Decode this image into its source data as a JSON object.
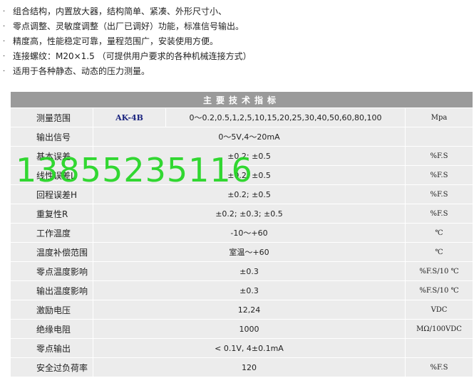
{
  "features": [
    {
      "bullet": "·",
      "text": "组合结构，内置放大器，结构简单、紧凑、外形尺寸小、"
    },
    {
      "bullet": "·",
      "text": "零点调整、灵敏度调整（出厂已调好）功能，标准信号输出。"
    },
    {
      "bullet": "·",
      "text": "精度高，性能稳定可靠，量程范围广，安装使用方便。"
    },
    {
      "bullet": "·",
      "text": "连接螺纹：M20×1.5 （可提供用户要求的各种机械连接方式）"
    },
    {
      "bullet": "·",
      "text": "适用于各种静态、动态的压力测量。"
    }
  ],
  "table": {
    "title": "主要技术指标",
    "range_row": {
      "name": "测量范围",
      "model": "AK-4B",
      "value": "0～0.2,0.5,1,2,5,10,15,20,25,30,40,50,60,80,100",
      "unit": "Mpa"
    },
    "rows": [
      {
        "name": "输出信号",
        "value": "0～5V,4～20mA",
        "unit": ""
      },
      {
        "name": "基本误差",
        "value": "±0.2; ±0.5",
        "unit": "%F.S"
      },
      {
        "name": "线性误差L",
        "value": "±0.2; ±0.5",
        "unit": "%F.S"
      },
      {
        "name": "回程误差H",
        "value": "±0.2; ±0.5",
        "unit": "%F.S"
      },
      {
        "name": "重复性R",
        "value": "±0.2; ±0.3; ±0.5",
        "unit": "%F.S"
      },
      {
        "name": "工作温度",
        "value": "-10～+60",
        "unit": "℃"
      },
      {
        "name": "温度补偿范围",
        "value": "室温～+60",
        "unit": "℃"
      },
      {
        "name": "零点温度影响",
        "value": "±0.3",
        "unit": "%F.S/10 ℃"
      },
      {
        "name": "输出温度影响",
        "value": "±0.3",
        "unit": "%F.S/10 ℃"
      },
      {
        "name": "激励电压",
        "value": "12,24",
        "unit": "VDC"
      },
      {
        "name": "绝缘电阻",
        "value": "1000",
        "unit": "MΩ/100VDC"
      },
      {
        "name": "零点输出",
        "value": "< 0.1V, 4±0.1mA",
        "unit": ""
      },
      {
        "name": "安全过负荷率",
        "value": "120",
        "unit": "%F.S"
      }
    ]
  },
  "watermark": "13855235116",
  "colors": {
    "header_bg": "#9a9a9a",
    "row_bg": "#ececec",
    "model_text": "#1a237e",
    "watermark": "#22d622"
  }
}
